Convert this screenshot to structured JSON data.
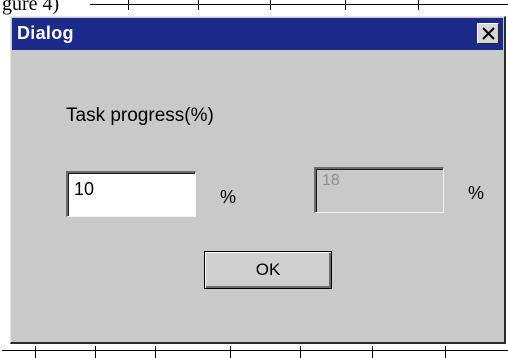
{
  "background": {
    "caption": "gure 4)"
  },
  "dialog": {
    "title": "Dialog",
    "close_icon": "close-x-icon",
    "task_label": "Task progress(%)",
    "progress_input_value": "10",
    "progress_unit": "%",
    "readonly_value": "18",
    "readonly_unit": "%",
    "ok_label": "OK"
  },
  "colors": {
    "titlebar": "#1c2a8a",
    "dialog_face": "#c9c9c9",
    "disabled_text": "#8d8d8d"
  }
}
